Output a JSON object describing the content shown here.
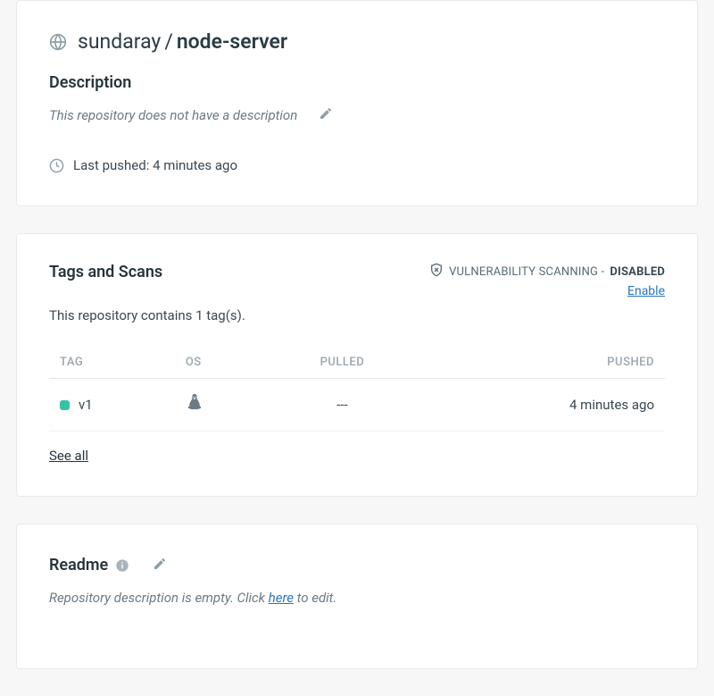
{
  "header": {
    "owner": "sundaray",
    "slash": "/",
    "name": "node-server",
    "description_heading": "Description",
    "description_placeholder": "This repository does not have a description",
    "last_pushed_label": "Last pushed: 4 minutes ago"
  },
  "tags": {
    "title": "Tags and Scans",
    "vuln_label": "VULNERABILITY SCANNING - ",
    "vuln_status": "DISABLED",
    "enable_label": "Enable",
    "count_text": "This repository contains 1 tag(s).",
    "columns": {
      "tag": "TAG",
      "os": "OS",
      "pulled": "PULLED",
      "pushed": "PUSHED"
    },
    "rows": [
      {
        "tag": "v1",
        "pulled": "---",
        "pushed": "4 minutes ago"
      }
    ],
    "see_all": "See all"
  },
  "readme": {
    "title": "Readme",
    "empty_prefix": "Repository description is empty. Click ",
    "here": "here",
    "empty_suffix": " to edit."
  }
}
